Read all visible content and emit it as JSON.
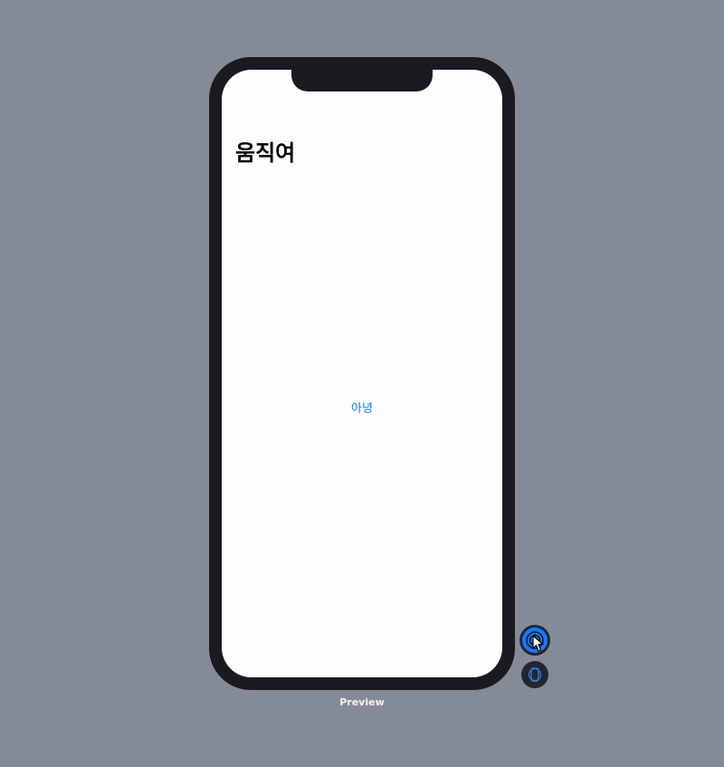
{
  "canvas": {
    "preview_label": "Preview"
  },
  "screen": {
    "nav_title": "움직여",
    "link_text": "아녕"
  },
  "controls": {
    "live_preview_icon": "live-preview-icon",
    "device_settings_icon": "device-settings-icon",
    "cursor_icon": "mouse-pointer-icon"
  },
  "colors": {
    "canvas_background": "#858b96",
    "device_frame": "#1b1a1e",
    "screen_background": "#fdfcff",
    "link_accent": "#1a7ef0",
    "active_control": "#1a78f2"
  }
}
